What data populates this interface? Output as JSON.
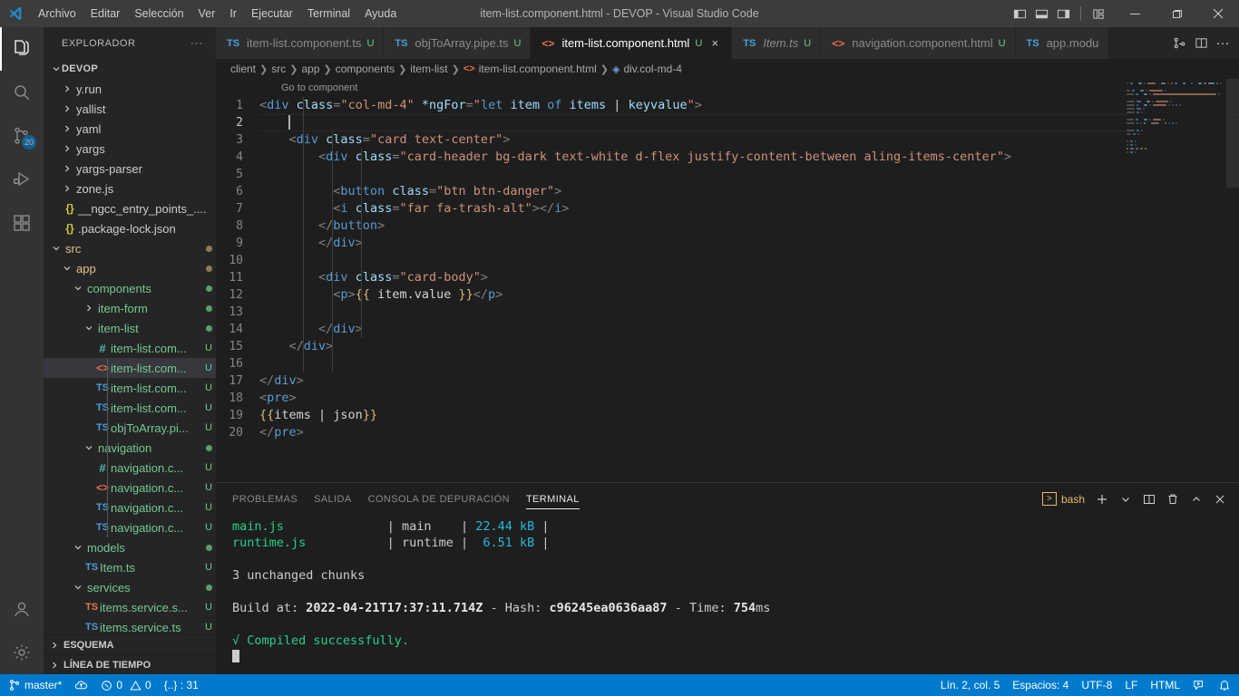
{
  "titlebar": {
    "logo_icon": "vscode-logo-icon",
    "menus": [
      "Archivo",
      "Editar",
      "Selección",
      "Ver",
      "Ir",
      "Ejecutar",
      "Terminal",
      "Ayuda"
    ],
    "window_title": "item-list.component.html - DEVOP - Visual Studio Code",
    "layout_icons": [
      "toggle-primary-sidebar-icon",
      "toggle-panel-icon",
      "toggle-secondary-sidebar-icon",
      "customize-layout-icon"
    ],
    "window_controls": [
      "minimize-icon",
      "maximize-icon",
      "close-icon"
    ]
  },
  "activitybar": {
    "items": [
      {
        "name": "explorer",
        "icon": "files-icon",
        "active": true,
        "badge": null
      },
      {
        "name": "search",
        "icon": "search-icon",
        "active": false,
        "badge": null
      },
      {
        "name": "source-control",
        "icon": "source-control-icon",
        "active": false,
        "badge": "20"
      },
      {
        "name": "run-debug",
        "icon": "run-and-debug-icon",
        "active": false,
        "badge": null
      },
      {
        "name": "extensions",
        "icon": "extensions-icon",
        "active": false,
        "badge": null
      }
    ],
    "bottom": [
      {
        "name": "accounts",
        "icon": "account-icon"
      },
      {
        "name": "settings",
        "icon": "gear-icon"
      }
    ]
  },
  "sidebar": {
    "title": "EXPLORADOR",
    "more_actions": "···",
    "folder": "DEVOP",
    "tree": [
      {
        "label": "y.run",
        "indent": 1,
        "kind": "folder",
        "chev": "right",
        "clipped": true
      },
      {
        "label": "yallist",
        "indent": 1,
        "kind": "folder",
        "chev": "right"
      },
      {
        "label": "yaml",
        "indent": 1,
        "kind": "folder",
        "chev": "right"
      },
      {
        "label": "yargs",
        "indent": 1,
        "kind": "folder",
        "chev": "right"
      },
      {
        "label": "yargs-parser",
        "indent": 1,
        "kind": "folder",
        "chev": "right"
      },
      {
        "label": "zone.js",
        "indent": 1,
        "kind": "folder",
        "chev": "right"
      },
      {
        "label": "__ngcc_entry_points_....",
        "indent": 1,
        "kind": "json"
      },
      {
        "label": ".package-lock.json",
        "indent": 1,
        "kind": "json"
      },
      {
        "label": "src",
        "indent": 0,
        "kind": "folder",
        "chev": "down",
        "dot": "brown"
      },
      {
        "label": "app",
        "indent": 1,
        "kind": "folder",
        "chev": "down",
        "dot": "brown"
      },
      {
        "label": "components",
        "indent": 2,
        "kind": "folder",
        "chev": "down",
        "dot": "green"
      },
      {
        "label": "item-form",
        "indent": 3,
        "kind": "folder",
        "chev": "right",
        "dot": "green"
      },
      {
        "label": "item-list",
        "indent": 3,
        "kind": "folder",
        "chev": "down",
        "dot": "green"
      },
      {
        "label": "item-list.com...",
        "indent": 4,
        "kind": "scss",
        "git": "U"
      },
      {
        "label": "item-list.com...",
        "indent": 4,
        "kind": "html",
        "git": "U",
        "selected": true
      },
      {
        "label": "item-list.com...",
        "indent": 4,
        "kind": "ts",
        "git": "U"
      },
      {
        "label": "item-list.com...",
        "indent": 4,
        "kind": "ts",
        "git": "U"
      },
      {
        "label": "objToArray.pi...",
        "indent": 4,
        "kind": "ts",
        "git": "U"
      },
      {
        "label": "navigation",
        "indent": 3,
        "kind": "folder",
        "chev": "down",
        "dot": "green"
      },
      {
        "label": "navigation.c...",
        "indent": 4,
        "kind": "scss",
        "git": "U"
      },
      {
        "label": "navigation.c...",
        "indent": 4,
        "kind": "html",
        "git": "U"
      },
      {
        "label": "navigation.c...",
        "indent": 4,
        "kind": "ts",
        "git": "U"
      },
      {
        "label": "navigation.c...",
        "indent": 4,
        "kind": "ts",
        "git": "U"
      },
      {
        "label": "models",
        "indent": 2,
        "kind": "folder",
        "chev": "down",
        "dot": "green"
      },
      {
        "label": "Item.ts",
        "indent": 3,
        "kind": "ts",
        "git": "U"
      },
      {
        "label": "services",
        "indent": 2,
        "kind": "folder",
        "chev": "down",
        "dot": "green"
      },
      {
        "label": "items.service.s...",
        "indent": 3,
        "kind": "ts-orange",
        "git": "U"
      },
      {
        "label": "items.service.ts",
        "indent": 3,
        "kind": "ts",
        "git": "U"
      }
    ],
    "sections": [
      "ESQUEMA",
      "LÍNEA DE TIEMPO"
    ]
  },
  "tabs": {
    "items": [
      {
        "label": "item-list.component.ts",
        "kind": "ts",
        "git": "U",
        "active": false,
        "italic": false
      },
      {
        "label": "objToArray.pipe.ts",
        "kind": "ts",
        "git": "U",
        "active": false,
        "italic": false
      },
      {
        "label": "item-list.component.html",
        "kind": "html",
        "git": "U",
        "active": true,
        "italic": false
      },
      {
        "label": "Item.ts",
        "kind": "ts",
        "git": "U",
        "active": false,
        "italic": true
      },
      {
        "label": "navigation.component.html",
        "kind": "html",
        "git": "U",
        "active": false,
        "italic": false
      },
      {
        "label": "app.modu",
        "kind": "ts",
        "git": "",
        "active": false,
        "italic": false
      }
    ],
    "actions": [
      "split-editor-right-icon",
      "open-changes-icon",
      "more-actions-icon"
    ]
  },
  "breadcrumb": {
    "parts": [
      "client",
      "src",
      "app",
      "components",
      "item-list",
      "item-list.component.html",
      "div.col-md-4"
    ]
  },
  "editor": {
    "codelens": "Go to component",
    "lines": [
      {
        "n": 1,
        "segments": [
          {
            "t": "<",
            "c": "t-punc"
          },
          {
            "t": "div",
            "c": "t-tag"
          },
          {
            "t": " ",
            "c": "t-txt"
          },
          {
            "t": "class",
            "c": "t-attr"
          },
          {
            "t": "=",
            "c": "t-punc"
          },
          {
            "t": "\"col-md-4\"",
            "c": "t-str"
          },
          {
            "t": " ",
            "c": "t-txt"
          },
          {
            "t": "*ngFor",
            "c": "t-attr"
          },
          {
            "t": "=",
            "c": "t-punc"
          },
          {
            "t": "\"",
            "c": "t-str"
          },
          {
            "t": "let",
            "c": "t-kw"
          },
          {
            "t": " ",
            "c": "t-txt"
          },
          {
            "t": "item",
            "c": "t-ident"
          },
          {
            "t": " ",
            "c": "t-txt"
          },
          {
            "t": "of",
            "c": "t-kw"
          },
          {
            "t": " ",
            "c": "t-txt"
          },
          {
            "t": "items",
            "c": "t-ident"
          },
          {
            "t": " | ",
            "c": "t-txt"
          },
          {
            "t": "keyvalue",
            "c": "t-ident"
          },
          {
            "t": "\"",
            "c": "t-str"
          },
          {
            "t": ">",
            "c": "t-punc"
          }
        ]
      },
      {
        "n": 2,
        "cursor": true,
        "indent": 4,
        "segments": []
      },
      {
        "n": 3,
        "segments": [
          {
            "t": "    <",
            "c": "t-punc"
          },
          {
            "t": "div",
            "c": "t-tag"
          },
          {
            "t": " ",
            "c": "t-txt"
          },
          {
            "t": "class",
            "c": "t-attr"
          },
          {
            "t": "=",
            "c": "t-punc"
          },
          {
            "t": "\"card text-center\"",
            "c": "t-str"
          },
          {
            "t": ">",
            "c": "t-punc"
          }
        ]
      },
      {
        "n": 4,
        "segments": [
          {
            "t": "        <",
            "c": "t-punc"
          },
          {
            "t": "div",
            "c": "t-tag"
          },
          {
            "t": " ",
            "c": "t-txt"
          },
          {
            "t": "class",
            "c": "t-attr"
          },
          {
            "t": "=",
            "c": "t-punc"
          },
          {
            "t": "\"card-header bg-dark text-white d-flex justify-content-between aling-items-center\"",
            "c": "t-str"
          },
          {
            "t": ">",
            "c": "t-punc"
          }
        ]
      },
      {
        "n": 5,
        "segments": []
      },
      {
        "n": 6,
        "segments": [
          {
            "t": "          <",
            "c": "t-punc"
          },
          {
            "t": "button",
            "c": "t-tag"
          },
          {
            "t": " ",
            "c": "t-txt"
          },
          {
            "t": "class",
            "c": "t-attr"
          },
          {
            "t": "=",
            "c": "t-punc"
          },
          {
            "t": "\"btn btn-danger\"",
            "c": "t-str"
          },
          {
            "t": ">",
            "c": "t-punc"
          }
        ]
      },
      {
        "n": 7,
        "segments": [
          {
            "t": "          <",
            "c": "t-punc"
          },
          {
            "t": "i",
            "c": "t-tag"
          },
          {
            "t": " ",
            "c": "t-txt"
          },
          {
            "t": "class",
            "c": "t-attr"
          },
          {
            "t": "=",
            "c": "t-punc"
          },
          {
            "t": "\"far fa-trash-alt\"",
            "c": "t-str"
          },
          {
            "t": ">",
            "c": "t-punc"
          },
          {
            "t": "</",
            "c": "t-punc"
          },
          {
            "t": "i",
            "c": "t-tag"
          },
          {
            "t": ">",
            "c": "t-punc"
          }
        ]
      },
      {
        "n": 8,
        "segments": [
          {
            "t": "        </",
            "c": "t-punc"
          },
          {
            "t": "button",
            "c": "t-tag"
          },
          {
            "t": ">",
            "c": "t-punc"
          }
        ]
      },
      {
        "n": 9,
        "segments": [
          {
            "t": "        </",
            "c": "t-punc"
          },
          {
            "t": "div",
            "c": "t-tag"
          },
          {
            "t": ">",
            "c": "t-punc"
          }
        ]
      },
      {
        "n": 10,
        "segments": []
      },
      {
        "n": 11,
        "segments": [
          {
            "t": "        <",
            "c": "t-punc"
          },
          {
            "t": "div",
            "c": "t-tag"
          },
          {
            "t": " ",
            "c": "t-txt"
          },
          {
            "t": "class",
            "c": "t-attr"
          },
          {
            "t": "=",
            "c": "t-punc"
          },
          {
            "t": "\"card-body\"",
            "c": "t-str"
          },
          {
            "t": ">",
            "c": "t-punc"
          }
        ]
      },
      {
        "n": 12,
        "segments": [
          {
            "t": "          <",
            "c": "t-punc"
          },
          {
            "t": "p",
            "c": "t-tag"
          },
          {
            "t": ">",
            "c": "t-punc"
          },
          {
            "t": "{{",
            "c": "t-brace"
          },
          {
            "t": " ",
            "c": "t-txt"
          },
          {
            "t": "item.value",
            "c": "t-txt"
          },
          {
            "t": " ",
            "c": "t-txt"
          },
          {
            "t": "}}",
            "c": "t-brace"
          },
          {
            "t": "</",
            "c": "t-punc"
          },
          {
            "t": "p",
            "c": "t-tag"
          },
          {
            "t": ">",
            "c": "t-punc"
          }
        ]
      },
      {
        "n": 13,
        "segments": []
      },
      {
        "n": 14,
        "segments": [
          {
            "t": "        </",
            "c": "t-punc"
          },
          {
            "t": "div",
            "c": "t-tag"
          },
          {
            "t": ">",
            "c": "t-punc"
          }
        ]
      },
      {
        "n": 15,
        "segments": [
          {
            "t": "    </",
            "c": "t-punc"
          },
          {
            "t": "div",
            "c": "t-tag"
          },
          {
            "t": ">",
            "c": "t-punc"
          }
        ]
      },
      {
        "n": 16,
        "segments": []
      },
      {
        "n": 17,
        "segments": [
          {
            "t": "</",
            "c": "t-punc"
          },
          {
            "t": "div",
            "c": "t-tag"
          },
          {
            "t": ">",
            "c": "t-punc"
          }
        ]
      },
      {
        "n": 18,
        "segments": [
          {
            "t": "<",
            "c": "t-punc"
          },
          {
            "t": "pre",
            "c": "t-tag"
          },
          {
            "t": ">",
            "c": "t-punc"
          }
        ]
      },
      {
        "n": 19,
        "segments": [
          {
            "t": "{{",
            "c": "t-brace"
          },
          {
            "t": "items",
            "c": "t-txt"
          },
          {
            "t": " | ",
            "c": "t-txt"
          },
          {
            "t": "json",
            "c": "t-txt"
          },
          {
            "t": "}}",
            "c": "t-brace"
          }
        ]
      },
      {
        "n": 20,
        "segments": [
          {
            "t": "</",
            "c": "t-punc"
          },
          {
            "t": "pre",
            "c": "t-tag"
          },
          {
            "t": ">",
            "c": "t-punc"
          }
        ]
      }
    ]
  },
  "panel": {
    "tabs": [
      "PROBLEMAS",
      "SALIDA",
      "CONSOLA DE DEPURACIÓN",
      "TERMINAL"
    ],
    "active_tab": "TERMINAL",
    "terminal_name": "bash",
    "actions": [
      "new-terminal-icon",
      "terminal-dropdown-icon",
      "split-terminal-icon",
      "kill-terminal-icon",
      "maximize-panel-icon",
      "close-panel-icon"
    ],
    "output": [
      [
        {
          "t": "main.js",
          "c": "c-green"
        },
        {
          "t": "              | ",
          "c": ""
        },
        {
          "t": "main",
          "c": ""
        },
        {
          "t": "    | ",
          "c": ""
        },
        {
          "t": "22.44 kB",
          "c": "c-cyan"
        },
        {
          "t": " |",
          "c": ""
        }
      ],
      [
        {
          "t": "runtime.js",
          "c": "c-green"
        },
        {
          "t": "           | ",
          "c": ""
        },
        {
          "t": "runtime",
          "c": ""
        },
        {
          "t": " | ",
          "c": ""
        },
        {
          "t": " 6.51 kB",
          "c": "c-cyan"
        },
        {
          "t": " |",
          "c": ""
        }
      ],
      [],
      [
        {
          "t": "3 unchanged chunks",
          "c": ""
        }
      ],
      [],
      [
        {
          "t": "Build at: ",
          "c": ""
        },
        {
          "t": "2022-04-21T17:37:11.714Z",
          "c": "c-bold"
        },
        {
          "t": " - Hash: ",
          "c": ""
        },
        {
          "t": "c96245ea0636aa87",
          "c": "c-bold"
        },
        {
          "t": " - Time: ",
          "c": ""
        },
        {
          "t": "754",
          "c": "c-bold"
        },
        {
          "t": "ms",
          "c": ""
        }
      ],
      [],
      [
        {
          "t": "√ Compiled successfully.",
          "c": "c-green"
        }
      ]
    ]
  },
  "statusbar": {
    "branch": "master*",
    "sync_icon": "sync-cloud-icon",
    "errors": "0",
    "warnings": "0",
    "ports": "{..} : 31",
    "position": "Lín. 2, col. 5",
    "indent": "Espacios: 4",
    "encoding": "UTF-8",
    "eol": "LF",
    "language": "HTML",
    "feedback_icon": "feedback-icon",
    "bell_icon": "bell-icon",
    "accent": "#007acc"
  }
}
